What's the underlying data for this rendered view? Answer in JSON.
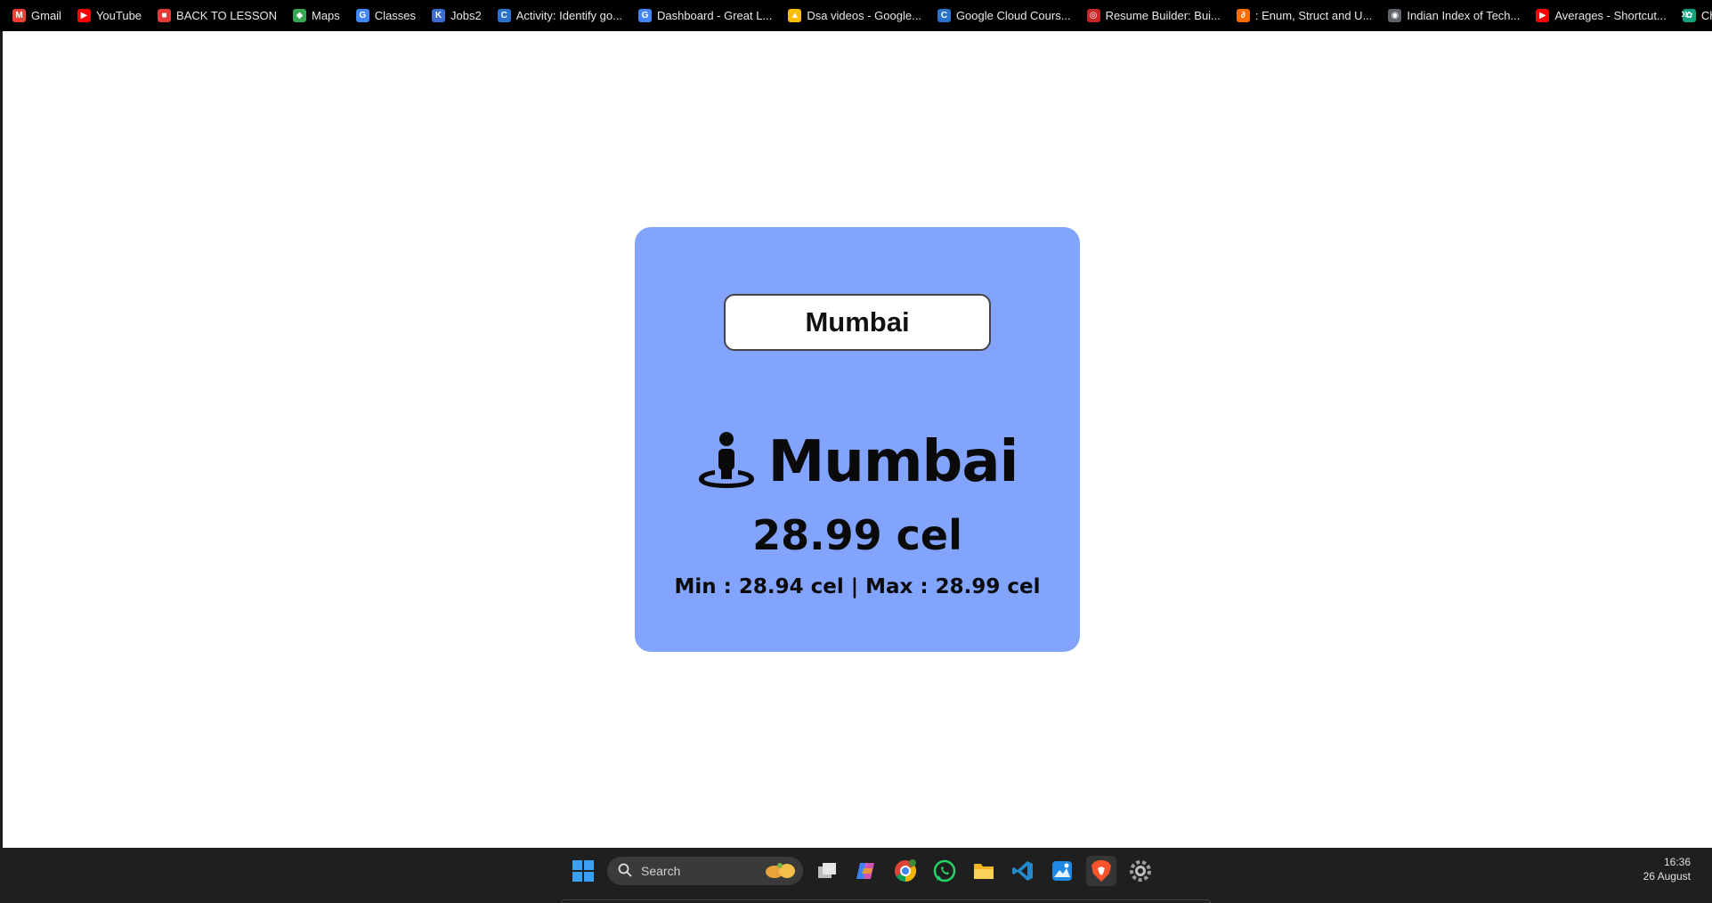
{
  "bookmarks": {
    "items": [
      {
        "label": "Gmail",
        "icon": "gmail-icon",
        "color": "#ea4335",
        "glyph": "M"
      },
      {
        "label": "YouTube",
        "icon": "youtube-icon",
        "color": "#ff0000",
        "glyph": "▶"
      },
      {
        "label": "BACK TO LESSON",
        "icon": "lesson-icon",
        "color": "#e53935",
        "glyph": "■"
      },
      {
        "label": "Maps",
        "icon": "maps-icon",
        "color": "#34a853",
        "glyph": "◆"
      },
      {
        "label": "Classes",
        "icon": "google-icon",
        "color": "#4285f4",
        "glyph": "G"
      },
      {
        "label": "Jobs2",
        "icon": "jobs-icon",
        "color": "#3b6cd4",
        "glyph": "K"
      },
      {
        "label": "Activity: Identify go...",
        "icon": "coursera-icon",
        "color": "#2a73cc",
        "glyph": "C"
      },
      {
        "label": "Dashboard - Great L...",
        "icon": "google-icon",
        "color": "#4285f4",
        "glyph": "G"
      },
      {
        "label": "Dsa videos - Google...",
        "icon": "drive-icon",
        "color": "#fbbc04",
        "glyph": "▲"
      },
      {
        "label": "Google Cloud Cours...",
        "icon": "coursera-icon",
        "color": "#2a73cc",
        "glyph": "C"
      },
      {
        "label": "Resume Builder: Bui...",
        "icon": "resume-icon",
        "color": "#c62828",
        "glyph": "◎"
      },
      {
        "label": ": Enum, Struct and U...",
        "icon": "link-icon",
        "color": "#ff6d00",
        "glyph": "∂"
      },
      {
        "label": "Indian Index of Tech...",
        "icon": "globe-icon",
        "color": "#5f6368",
        "glyph": "◉"
      },
      {
        "label": "Averages - Shortcut...",
        "icon": "youtube-icon",
        "color": "#ff0000",
        "glyph": "▶"
      },
      {
        "label": "ChatGPT",
        "icon": "chatgpt-icon",
        "color": "#10a37f",
        "glyph": "✿"
      }
    ],
    "more_label": "»"
  },
  "weather": {
    "input_value": "Mumbai",
    "city": "Mumbai",
    "location_icon": "street-view-icon",
    "temperature": "28.99 cel",
    "minmax": "Min : 28.94 cel | Max : 28.99 cel",
    "card_color": "#83a4fc"
  },
  "taskbar": {
    "search_label": "Search",
    "time": "16:36",
    "date": "26 August",
    "apps": [
      {
        "name": "start-icon"
      },
      {
        "name": "task-view-icon"
      },
      {
        "name": "copilot-icon"
      },
      {
        "name": "chrome-icon"
      },
      {
        "name": "whatsapp-icon"
      },
      {
        "name": "file-explorer-icon"
      },
      {
        "name": "vscode-icon"
      },
      {
        "name": "photos-icon"
      },
      {
        "name": "brave-icon",
        "active": true
      },
      {
        "name": "settings-icon"
      }
    ]
  }
}
